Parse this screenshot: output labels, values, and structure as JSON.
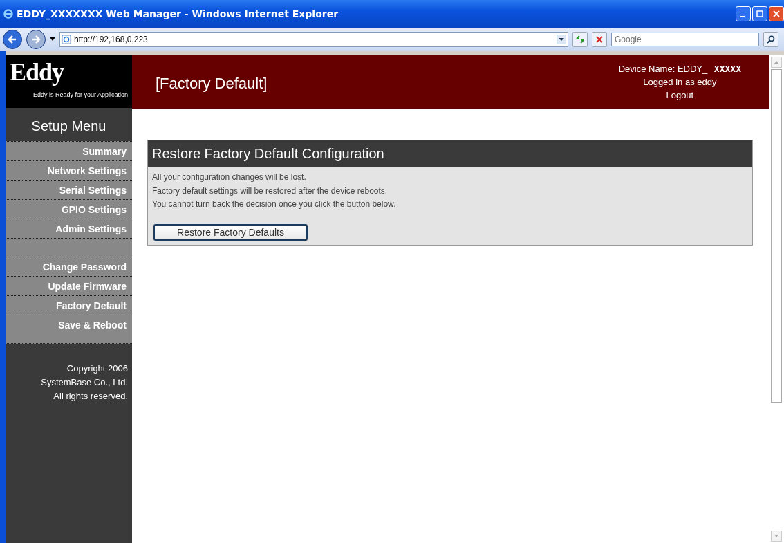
{
  "window": {
    "title": "EDDY_XXXXXXX Web Manager - Windows Internet Explorer"
  },
  "address_bar": {
    "url": "http://192,168,0,223"
  },
  "search": {
    "placeholder": "Google"
  },
  "logo": {
    "name": "Eddy",
    "tagline": "Eddy is Ready for your Application"
  },
  "page_title": "[Factory Default]",
  "device_info": {
    "label": "Device Name: EDDY_ ",
    "value": "XXXXX",
    "user": "Logged in as eddy",
    "logout": "Logout"
  },
  "sidebar": {
    "heading": "Setup Menu",
    "groups": [
      {
        "items": [
          "Summary",
          "Network Settings",
          "Serial Settings",
          "GPIO Settings",
          "Admin Settings"
        ]
      },
      {
        "items": [
          "Change Password",
          "Update Firmware",
          "Factory Default",
          "Save & Reboot"
        ]
      }
    ],
    "copyright": [
      "Copyright 2006",
      "SystemBase Co., Ltd.",
      "All rights reserved."
    ]
  },
  "panel": {
    "title": "Restore Factory Default Configuration",
    "lines": [
      "All your configuration changes will be lost.",
      "Factory default settings will be restored after the device reboots.",
      "You cannot turn back the decision once you click the button below."
    ],
    "button": "Restore Factory Defaults"
  }
}
